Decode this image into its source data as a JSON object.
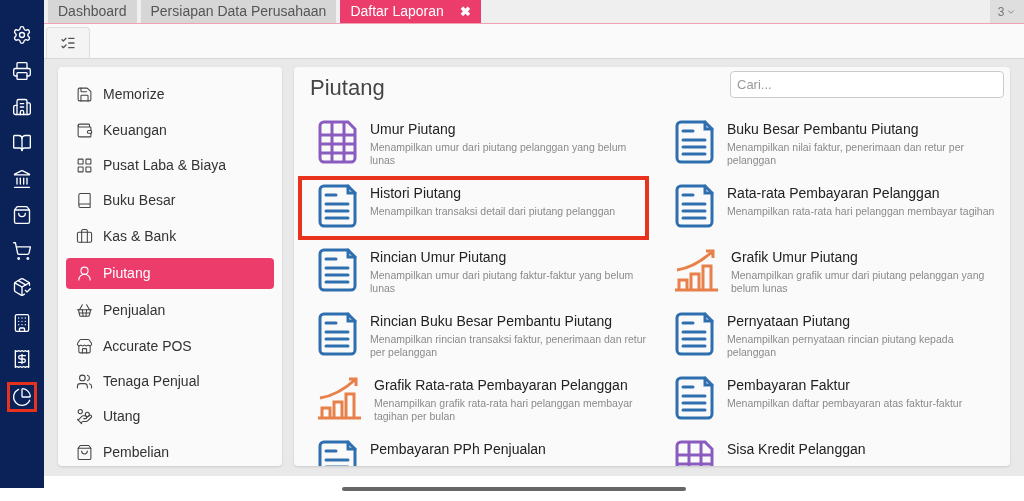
{
  "rail": {
    "items": [
      {
        "highlighted": false
      },
      {
        "highlighted": false
      },
      {
        "highlighted": false
      },
      {
        "highlighted": false
      },
      {
        "highlighted": false
      },
      {
        "highlighted": false
      },
      {
        "highlighted": false
      },
      {
        "highlighted": false
      },
      {
        "highlighted": false
      },
      {
        "highlighted": false
      },
      {
        "highlighted": true
      }
    ]
  },
  "tabs": [
    {
      "label": "Dashboard",
      "selected": false
    },
    {
      "label": "Persiapan Data Perusahaan",
      "selected": false
    },
    {
      "label": "Daftar Laporan",
      "selected": true,
      "close": "✖"
    }
  ],
  "tab_overflow": {
    "count": "3"
  },
  "categories": [
    {
      "label": "Memorize",
      "selected": false
    },
    {
      "label": "Keuangan",
      "selected": false
    },
    {
      "label": "Pusat Laba & Biaya",
      "selected": false
    },
    {
      "label": "Buku Besar",
      "selected": false
    },
    {
      "label": "Kas & Bank",
      "selected": false
    },
    {
      "label": "Piutang",
      "selected": true
    },
    {
      "label": "Penjualan",
      "selected": false
    },
    {
      "label": "Accurate POS",
      "selected": false
    },
    {
      "label": "Tenaga Penjual",
      "selected": false
    },
    {
      "label": "Utang",
      "selected": false
    },
    {
      "label": "Pembelian",
      "selected": false
    }
  ],
  "reports": {
    "title": "Piutang",
    "search": {
      "placeholder": "Cari..."
    },
    "items": [
      {
        "kind": "table",
        "title": "Umur Piutang",
        "description": "Menampilkan umur dari piutang pelanggan yang belum lunas",
        "highlighted": false
      },
      {
        "kind": "document",
        "title": "Buku Besar Pembantu Piutang",
        "description": "Menampilkan nilai faktur, penerimaan dan retur per pelanggan",
        "highlighted": false
      },
      {
        "kind": "document",
        "title": "Histori Piutang",
        "description": "Menampilkan transaksi detail dari piutang pelanggan",
        "highlighted": true
      },
      {
        "kind": "document",
        "title": "Rata-rata Pembayaran Pelanggan",
        "description": "Menampilkan rata-rata hari pelanggan membayar tagihan",
        "highlighted": false
      },
      {
        "kind": "document",
        "title": "Rincian Umur Piutang",
        "description": "Menampilkan umur dari piutang faktur-faktur yang belum lunas",
        "highlighted": false
      },
      {
        "kind": "chart",
        "title": "Grafik Umur Piutang",
        "description": "Menampilkan grafik umur dari piutang pelanggan yang belum lunas",
        "highlighted": false
      },
      {
        "kind": "document",
        "title": "Rincian Buku Besar Pembantu Piutang",
        "description": "Menampilkan rincian transaksi faktur, penerimaan dan retur per pelanggan",
        "highlighted": false
      },
      {
        "kind": "document",
        "title": "Pernyataan Piutang",
        "description": "Menampilkan pernyataan rincian piutang kepada pelanggan",
        "highlighted": false
      },
      {
        "kind": "chart",
        "title": "Grafik Rata-rata Pembayaran Pelanggan",
        "description": "Menampilkan grafik rata-rata hari pelanggan membayar tagihan per bulan",
        "highlighted": false
      },
      {
        "kind": "document",
        "title": "Pembayaran Faktur",
        "description": "Menampilkan daftar pembayaran atas faktur-faktur",
        "highlighted": false
      },
      {
        "kind": "document",
        "title": "Pembayaran PPh Penjualan",
        "highlighted": false
      },
      {
        "kind": "table",
        "title": "Sisa Kredit Pelanggan",
        "highlighted": false
      }
    ]
  }
}
